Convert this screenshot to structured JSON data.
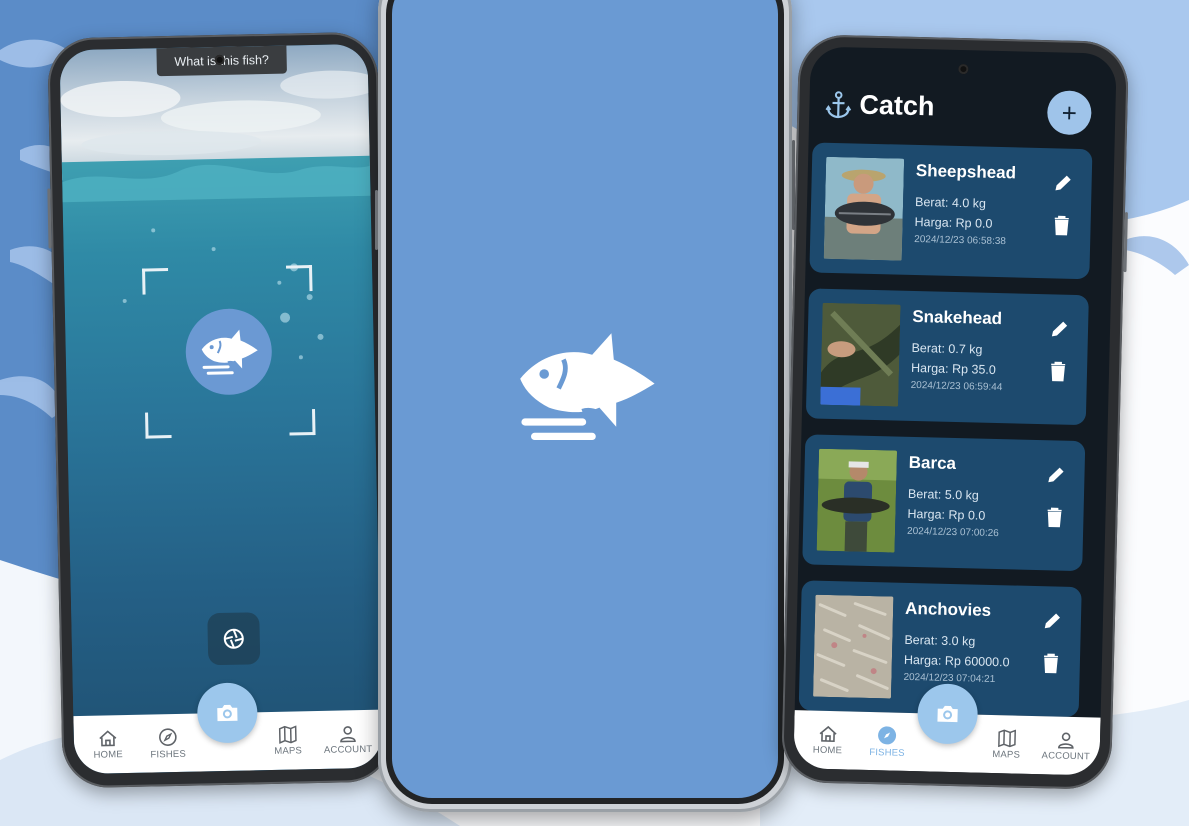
{
  "scan_screen": {
    "hint": "What is this fish?"
  },
  "catch_screen": {
    "title": "Catch",
    "add_label": "+",
    "catches": [
      {
        "name": "Sheepshead",
        "weight": "Berat: 4.0 kg",
        "price": "Harga: Rp 0.0",
        "date": "2024/12/23 06:58:38"
      },
      {
        "name": "Snakehead",
        "weight": "Berat: 0.7 kg",
        "price": "Harga: Rp 35.0",
        "date": "2024/12/23 06:59:44"
      },
      {
        "name": "Barca",
        "weight": "Berat: 5.0 kg",
        "price": "Harga: Rp 0.0",
        "date": "2024/12/23 07:00:26"
      },
      {
        "name": "Anchovies",
        "weight": "Berat: 3.0 kg",
        "price": "Harga: Rp 60000.0",
        "date": "2024/12/23 07:04:21"
      }
    ]
  },
  "nav": {
    "home": "HOME",
    "fishes": "FISHES",
    "maps": "MAPS",
    "account": "ACCOUNT"
  },
  "colors": {
    "brand_blue": "#6a9ad3",
    "card_bg": "#1d4a6e",
    "active_nav": "#7db3e4"
  },
  "icons": [
    "fish-logo-icon",
    "camera-icon",
    "shutter-icon",
    "anchor-icon",
    "pencil-icon",
    "trash-icon",
    "home-icon",
    "compass-icon",
    "map-icon",
    "account-icon"
  ]
}
